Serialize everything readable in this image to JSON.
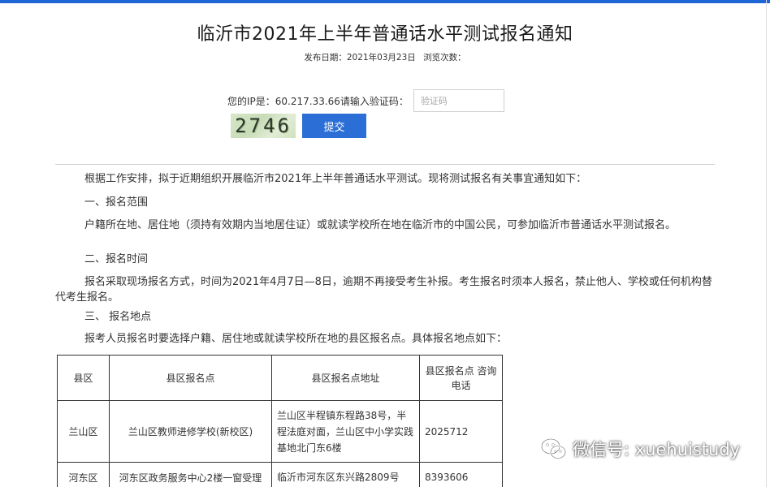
{
  "title": "临沂市2021年上半年普通话水平测试报名通知",
  "meta": {
    "publish_date": "发布日期：2021年03月23日",
    "views": "浏览次数："
  },
  "verify": {
    "ip_label": "您的IP是：60.217.33.66请输入验证码：",
    "input_placeholder": "验证码",
    "captcha_text": "2746",
    "submit_label": "提交"
  },
  "body": {
    "intro": "根据工作安排，拟于近期组织开展临沂市2021年上半年普通话水平测试。现将测试报名有关事宜通知如下：",
    "section1_title": "一、报名范围",
    "section1_text": "户籍所在地、居住地（须持有效期内当地居住证）或就读学校所在地在临沂市的中国公民，可参加临沂市普通话水平测试报名。",
    "section2_title": "二、报名时间",
    "section2_text": "报名采取现场报名方式，时间为2021年4月7日—8日，逾期不再接受考生补报。考生报名时须本人报名，禁止他人、学校或任何机构替代考生报名。",
    "section3_title": "三、 报名地点",
    "section3_text": "报考人员报名时要选择户籍、居住地或就读学校所在地的县区报名点。具体报名地点如下："
  },
  "table": {
    "headers": [
      "县区",
      "县区报名点",
      "县区报名点地址",
      "县区报名点 咨询电话"
    ],
    "rows": [
      [
        "兰山区",
        "兰山区教师进修学校(新校区)",
        "兰山区半程镇东程路38号，半程法庭对面，兰山区中小学实践基地北门东6楼",
        "2025712"
      ],
      [
        "河东区",
        "河东区政务服务中心2楼一窗受理",
        "临沂市河东区东兴路2809号",
        "8393606"
      ]
    ]
  },
  "watermark": {
    "icon": "wechat-icon",
    "text": "微信号: xuehuistudy"
  }
}
